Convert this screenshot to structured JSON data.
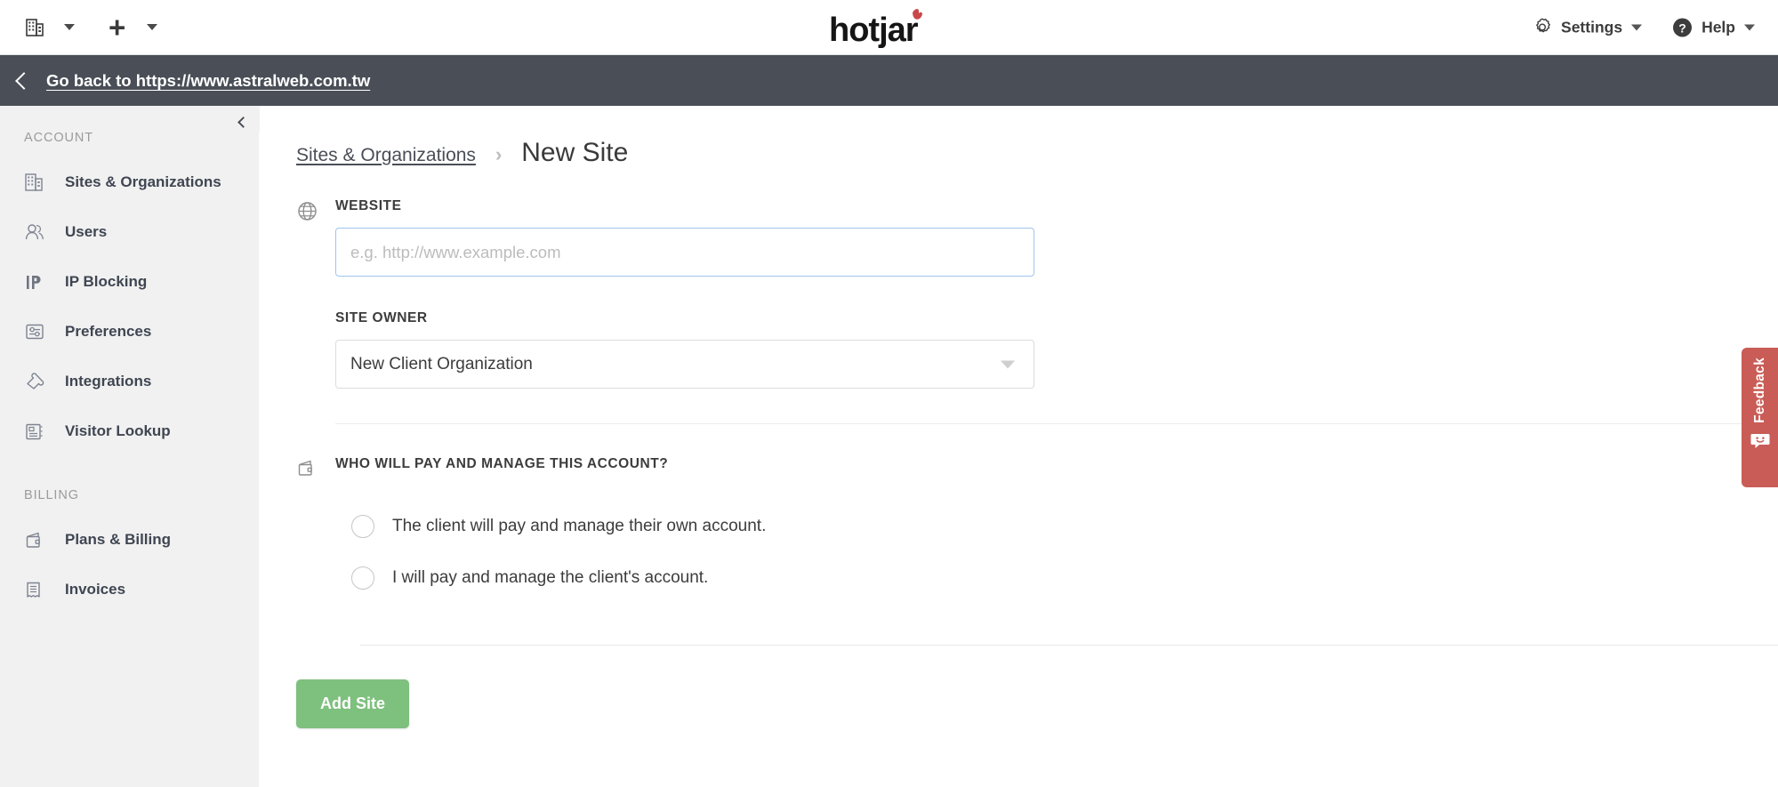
{
  "topbar": {
    "org_switcher_icon": "building-icon",
    "org_switcher_caret_icon": "chevron-down-icon",
    "add_icon": "plus-icon",
    "add_caret_icon": "chevron-down-icon",
    "logo_text": "hotjar",
    "logo_accent_color": "#c8484a",
    "settings_label": "Settings",
    "settings_icon": "gear-icon",
    "help_label": "Help",
    "help_icon": "question-circle-icon"
  },
  "darkbar": {
    "back_icon": "chevron-left-icon",
    "back_label": "Go back to https://www.astralweb.com.tw",
    "background_color": "#4a4e57"
  },
  "sidebar": {
    "collapse_icon": "chevron-left-icon",
    "sections": [
      {
        "title": "ACCOUNT",
        "items": [
          {
            "label": "Sites & Organizations",
            "icon": "building-icon"
          },
          {
            "label": "Users",
            "icon": "users-icon"
          },
          {
            "label": "IP Blocking",
            "icon": "ip-icon"
          },
          {
            "label": "Preferences",
            "icon": "sliders-icon"
          },
          {
            "label": "Integrations",
            "icon": "puzzle-icon"
          },
          {
            "label": "Visitor Lookup",
            "icon": "notebook-icon"
          }
        ]
      },
      {
        "title": "BILLING",
        "items": [
          {
            "label": "Plans & Billing",
            "icon": "wallet-icon"
          },
          {
            "label": "Invoices",
            "icon": "receipt-icon"
          }
        ]
      }
    ]
  },
  "main": {
    "breadcrumb": {
      "parent": "Sites & Organizations",
      "separator": "›",
      "current": "New Site"
    },
    "website_field": {
      "icon": "globe-icon",
      "label": "WEBSITE",
      "value": "",
      "placeholder": "e.g. http://www.example.com",
      "border_color": "#9fc3ee"
    },
    "site_owner_field": {
      "label": "SITE OWNER",
      "value": "New Client Organization",
      "caret_icon": "chevron-down-icon"
    },
    "payer_field": {
      "icon": "wallet-icon",
      "label": "WHO WILL PAY AND MANAGE THIS ACCOUNT?",
      "options": [
        {
          "label": "The client will pay and manage their own account.",
          "selected": false
        },
        {
          "label": "I will pay and manage the client's account.",
          "selected": false
        }
      ]
    },
    "submit_button": {
      "label": "Add Site",
      "color": "#7ec07e"
    }
  },
  "feedback_tab": {
    "label": "Feedback",
    "icon": "smiley-face-icon",
    "color": "#c95c56"
  }
}
